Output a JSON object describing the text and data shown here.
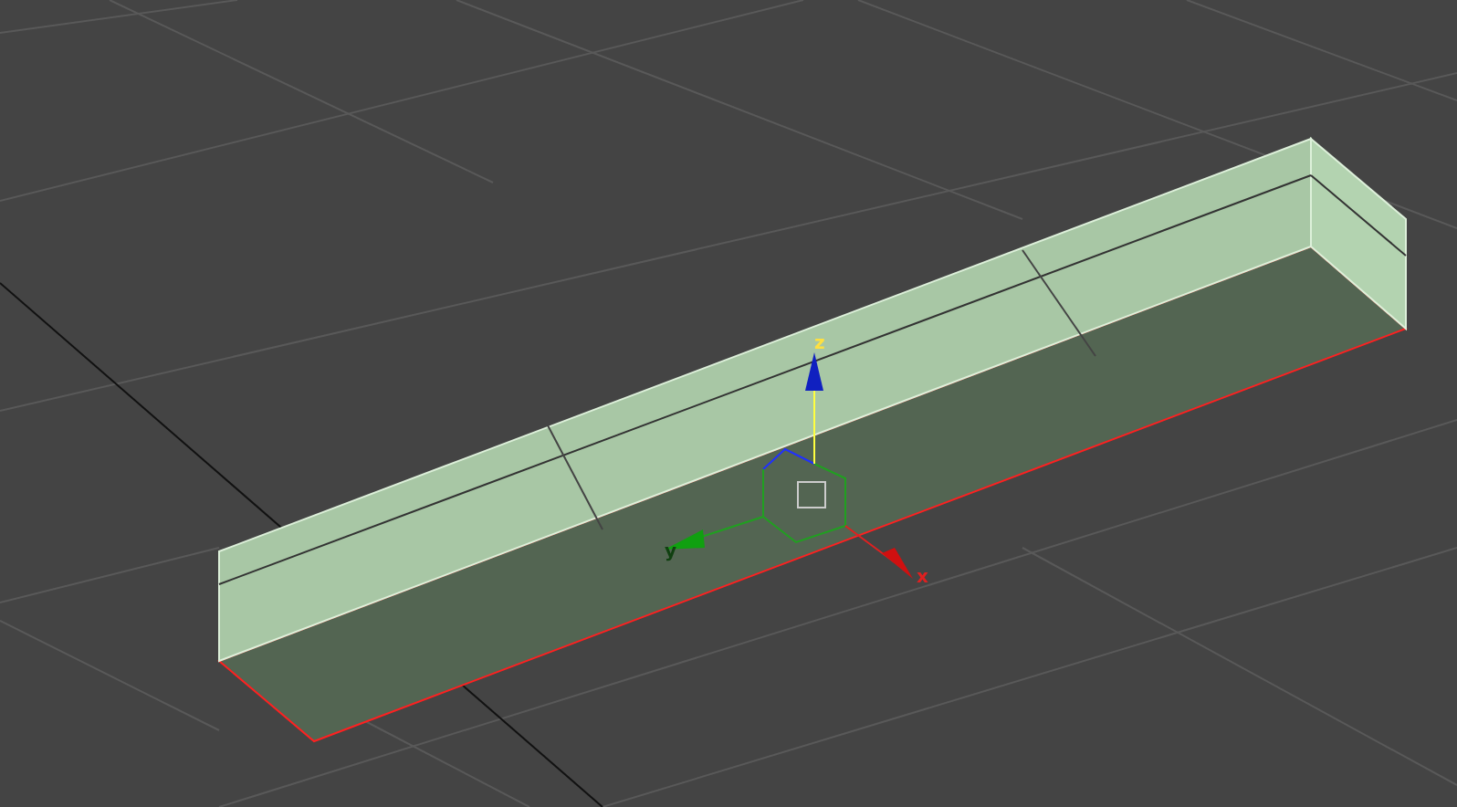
{
  "viewport": {
    "gizmo_axes": [
      {
        "kind": "z",
        "label": "z"
      },
      {
        "kind": "y",
        "label": "y"
      },
      {
        "kind": "x",
        "label": "x"
      }
    ]
  }
}
